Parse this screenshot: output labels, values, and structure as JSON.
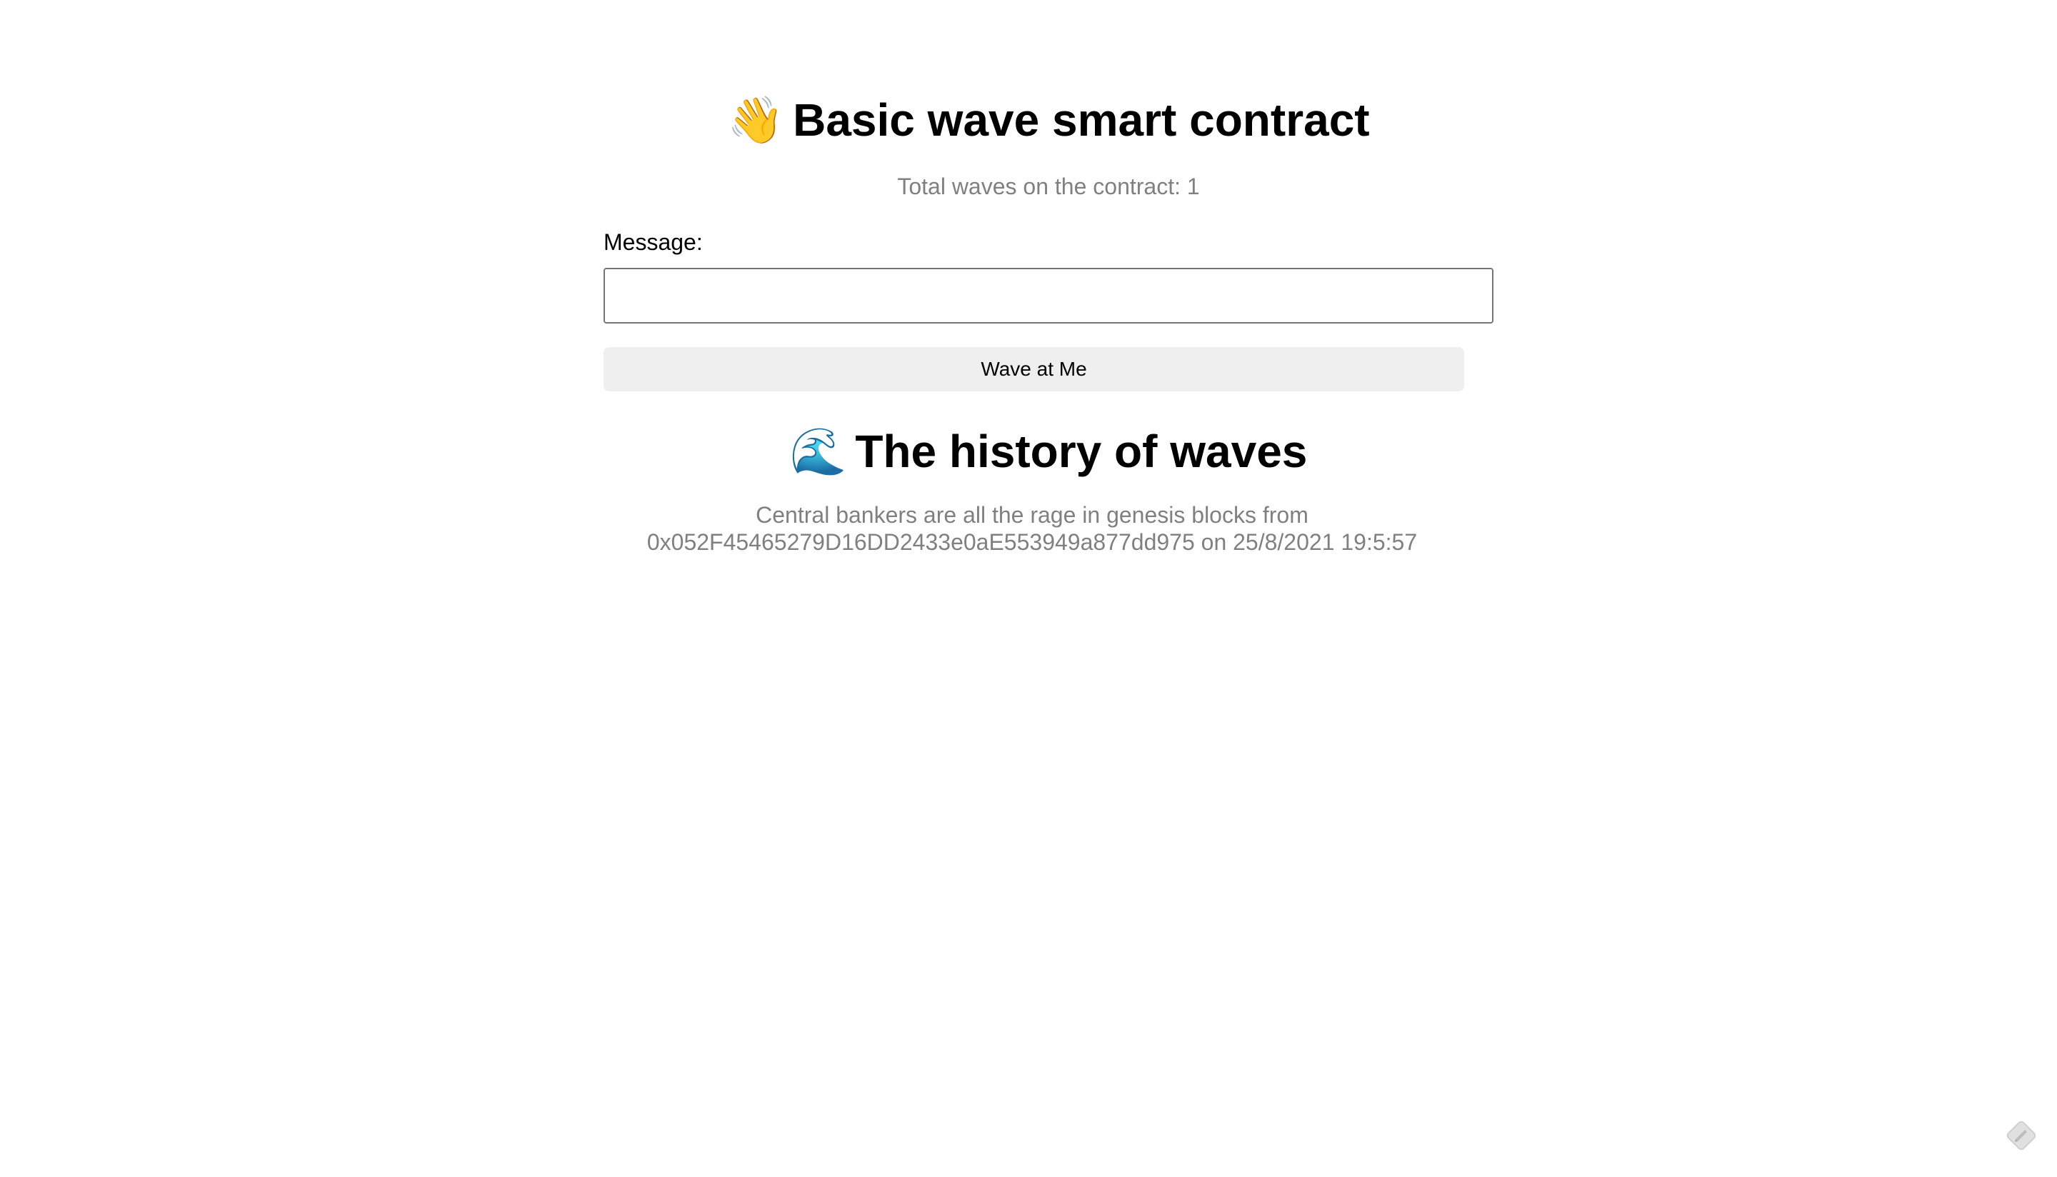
{
  "header": {
    "emoji": "👋",
    "title": "Basic wave smart contract",
    "total_waves_text": "Total waves on the contract: 1"
  },
  "form": {
    "message_label": "Message:",
    "message_value": "",
    "message_placeholder": "",
    "wave_button_label": "Wave at Me"
  },
  "history": {
    "emoji": "🌊",
    "title": "The history of waves",
    "waves": [
      {
        "message_line": "Central bankers are all the rage in genesis blocks from",
        "detail_line": "0x052F45465279D16DD2433e0aE553949a877dd975 on 25/8/2021 19:5:57"
      }
    ]
  },
  "icons": {
    "wave_hand": "waving-hand-icon",
    "ocean_wave": "ocean-wave-icon",
    "corner": "feedback-pencil-icon"
  },
  "colors": {
    "background": "#ffffff",
    "muted_text": "#808080",
    "button_bg": "#efefef",
    "input_border": "#767676"
  }
}
